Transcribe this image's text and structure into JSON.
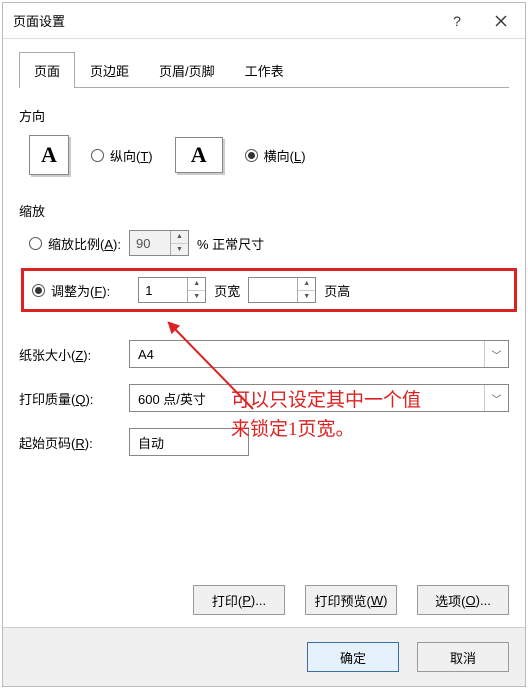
{
  "dialog": {
    "title": "页面设置"
  },
  "tabs": {
    "page": "页面",
    "margin": "页边距",
    "headerFooter": "页眉/页脚",
    "sheet": "工作表"
  },
  "orientation": {
    "label": "方向",
    "portrait": "纵向(T)",
    "landscape": "横向(L)",
    "iconLetter": "A"
  },
  "scale": {
    "label": "缩放",
    "ratioLabel": "缩放比例(A):",
    "ratioValue": "90",
    "ratioSuffix": "% 正常尺寸",
    "fitLabel": "调整为(F):",
    "fitWidth": "1",
    "fitWidthSuffix": "页宽",
    "fitHeight": "",
    "fitHeightSuffix": "页高"
  },
  "paper": {
    "label": "纸张大小(Z):",
    "value": "A4"
  },
  "quality": {
    "label": "打印质量(Q):",
    "value": "600 点/英寸"
  },
  "startPage": {
    "label": "起始页码(R):",
    "value": "自动"
  },
  "annotation": {
    "line1": "可以只设定其中一个值",
    "line2": "来锁定1页宽。"
  },
  "buttons": {
    "print": "打印(P)...",
    "preview": "打印预览(W)",
    "options": "选项(O)...",
    "ok": "确定",
    "cancel": "取消"
  }
}
